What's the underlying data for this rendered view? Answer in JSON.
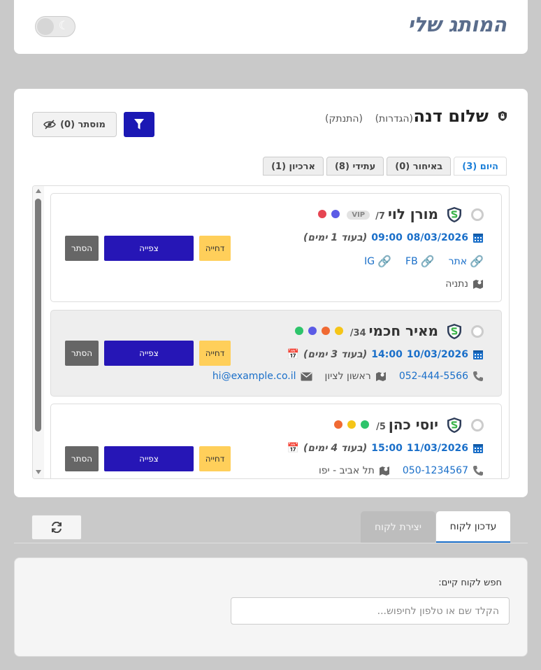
{
  "header": {
    "brand": "המותג שלי",
    "theme_toggle_icon": "moon-icon"
  },
  "user": {
    "name": "שלום דנה",
    "settings_link": "(הגדרות)",
    "logout_link": "(התנתק)"
  },
  "toolbar": {
    "hidden_label": "מוסתר (0)",
    "hidden_icon": "eye-slash-icon",
    "filter_icon": "filter-icon"
  },
  "tabs": [
    {
      "label": "היום",
      "count": "(3)",
      "active": true
    },
    {
      "label": "באיחור",
      "count": "(0)",
      "active": false
    },
    {
      "label": "עתידי",
      "count": "(8)",
      "active": false
    },
    {
      "label": "ארכיון",
      "count": "(1)",
      "active": false
    }
  ],
  "appointments": [
    {
      "name": "מורן לוי",
      "number": "7/",
      "vip": "VIP",
      "tag_colors": [
        "#5b5be6",
        "#e64552"
      ],
      "date": "08/03/2026",
      "time": "09:00",
      "relative": "(בעוד 1 ימים)",
      "links": [
        "אתר",
        "FB",
        "IG"
      ],
      "city": "נתניה",
      "hide_label": "הסתר",
      "view_label": "צפייה",
      "defer_label": "דחייה"
    },
    {
      "name": "מאיר חכמי",
      "number": "34/",
      "tag_colors": [
        "#f5c518",
        "#f06a33",
        "#5b5be6",
        "#2ec46b"
      ],
      "date": "10/03/2026",
      "time": "14:00",
      "relative": "(בעוד 3 ימים)",
      "phone": "052-444-5566",
      "city": "ראשון לציון",
      "email": "hi@example.co.il",
      "hide_label": "הסתר",
      "view_label": "צפייה",
      "defer_label": "דחייה"
    },
    {
      "name": "יוסי כהן",
      "number": "5/",
      "tag_colors": [
        "#2ec46b",
        "#f5c518",
        "#f06a33"
      ],
      "date": "11/03/2026",
      "time": "15:00",
      "relative": "(בעוד 4 ימים)",
      "phone": "050-1234567",
      "city": "תל אביב - יפו",
      "hide_label": "הסתר",
      "view_label": "צפייה",
      "defer_label": "דחייה"
    }
  ],
  "bottom_tabs": {
    "update_label": "עדכון לקוח",
    "create_label": "יצירת לקוח"
  },
  "search": {
    "label": "חפש לקוח קיים:",
    "placeholder": "הקלד שם או טלפון לחיפוש..."
  },
  "colors": {
    "primary": "#2616b6",
    "link": "#1a6fc9",
    "defer": "#ffcf5a",
    "hide": "#666666"
  }
}
